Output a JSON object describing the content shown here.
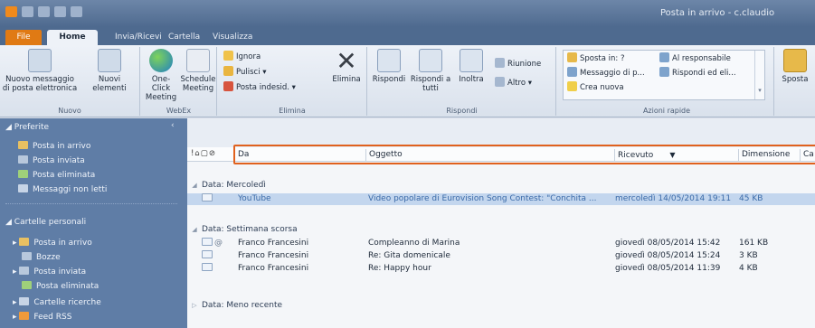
{
  "window": {
    "title": "Posta in arrivo - c.claudio"
  },
  "tabs": [
    "File",
    "Home",
    "Invia/Ricevi",
    "Cartella",
    "Visualizza"
  ],
  "ribbon": {
    "nuovo": {
      "btn1": "Nuovo messaggio di posta elettronica",
      "btn2": "Nuovi elementi",
      "label": "Nuovo"
    },
    "webex": {
      "btn1": "One-Click Meeting",
      "btn2": "Schedule Meeting",
      "label": "WebEx"
    },
    "elimina": {
      "ignora": "Ignora",
      "pulisci": "Pulisci",
      "posta_indesid": "Posta indesid.",
      "elimina": "Elimina",
      "label": "Elimina"
    },
    "rispondi": {
      "rispondi": "Rispondi",
      "rispondi_tutti": "Rispondi a tutti",
      "inoltra": "Inoltra",
      "riunione": "Riunione",
      "altro": "Altro",
      "label": "Rispondi"
    },
    "azioni_rapide": {
      "sposta_in": "Sposta in: ?",
      "messaggio": "Messaggio di p...",
      "crea_nuova": "Crea nuova",
      "al_responsabile": "Al responsabile",
      "rispondi_ed_eli": "Rispondi ed eli...",
      "label": "Azioni rapide"
    },
    "sposta": {
      "label": "Sposta"
    }
  },
  "nav": {
    "preferite_title": "Preferite",
    "preferite": [
      "Posta in arrivo",
      "Posta inviata",
      "Posta eliminata",
      "Messaggi non letti"
    ],
    "personali_title": "Cartelle personali",
    "personali": [
      "Posta in arrivo",
      "Bozze",
      "Posta inviata",
      "Posta eliminata",
      "Cartelle ricerche",
      "Feed RSS"
    ]
  },
  "columns": {
    "da": "Da",
    "oggetto": "Oggetto",
    "ricevuto": "Ricevuto",
    "dimensione": "Dimensione",
    "cat": "Ca"
  },
  "groups": [
    {
      "label": "Data: Mercoledì",
      "rows": [
        {
          "from": "YouTube",
          "subject": "Video popolare di Eurovision Song Contest: \"Conchita ...",
          "received": "mercoledì 14/05/2014 19:11",
          "size": "45 KB"
        }
      ]
    },
    {
      "label": "Data: Settimana scorsa",
      "rows": [
        {
          "from": "Franco Francesini",
          "subject": "Compleanno di Marina",
          "received": "giovedì 08/05/2014 15:42",
          "size": "161 KB"
        },
        {
          "from": "Franco Francesini",
          "subject": "Re: Gita domenicale",
          "received": "giovedì 08/05/2014 15:24",
          "size": "3 KB"
        },
        {
          "from": "Franco Francesini",
          "subject": "Re: Happy hour",
          "received": "giovedì 08/05/2014 11:39",
          "size": "4 KB"
        }
      ]
    },
    {
      "label": "Data: Meno recente",
      "rows": []
    }
  ],
  "colors": {
    "accent": "#e0611e",
    "selected_row": "#c3d6ee",
    "nav_bg": "#5f7da6"
  }
}
